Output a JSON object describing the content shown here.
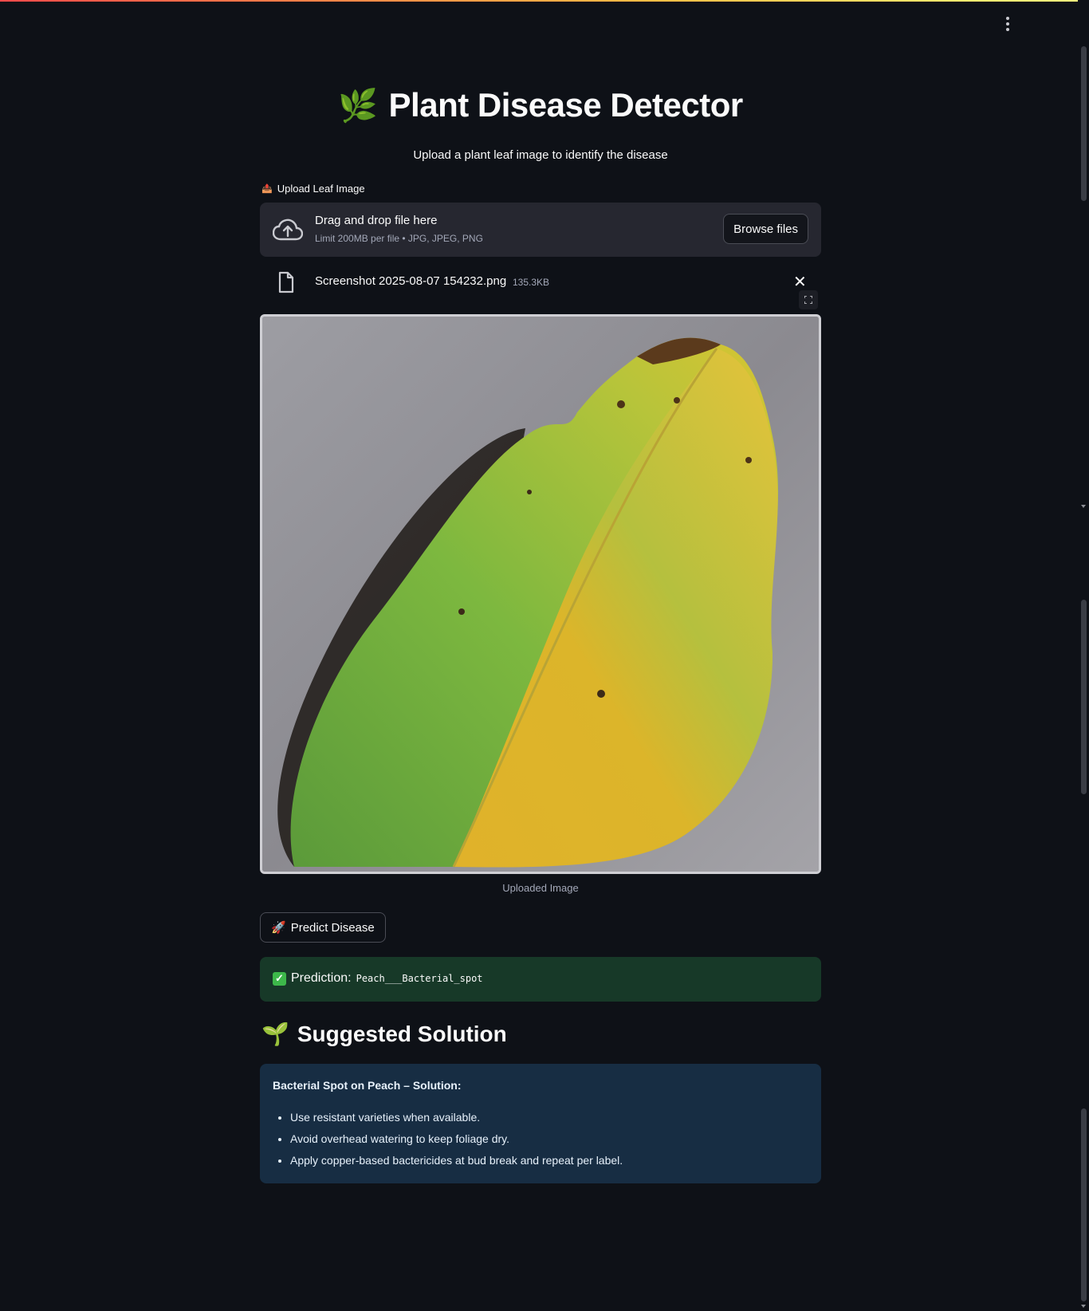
{
  "header": {
    "menu_icon": "kebab-menu-icon"
  },
  "page": {
    "title": "Plant Disease Detector",
    "title_emoji": "🌿",
    "subtitle": "Upload a plant leaf image to identify the disease"
  },
  "uploader": {
    "label": "Upload Leaf Image",
    "label_icon": "📤",
    "drop_title": "Drag and drop file here",
    "drop_subtitle": "Limit 200MB per file • JPG, JPEG, PNG",
    "browse_label": "Browse files",
    "file_name": "Screenshot 2025-08-07 154232.png",
    "file_size": "135.3KB"
  },
  "image": {
    "caption": "Uploaded Image"
  },
  "predict": {
    "button_label": "Predict Disease",
    "button_emoji": "🚀"
  },
  "result": {
    "prefix": "Prediction:",
    "value": "Peach___Bacterial_spot",
    "status_color": "#173928"
  },
  "solution": {
    "heading": "Suggested Solution",
    "heading_emoji": "🌱",
    "title": "Bacterial Spot on Peach – Solution:",
    "items": [
      "Use resistant varieties when available.",
      "Avoid overhead watering to keep foliage dry.",
      "Apply copper-based bactericides at bud break and repeat per label."
    ],
    "box_color": "#172d43"
  },
  "theme": {
    "background": "#0e1117",
    "accent": "#ff4b4b"
  }
}
